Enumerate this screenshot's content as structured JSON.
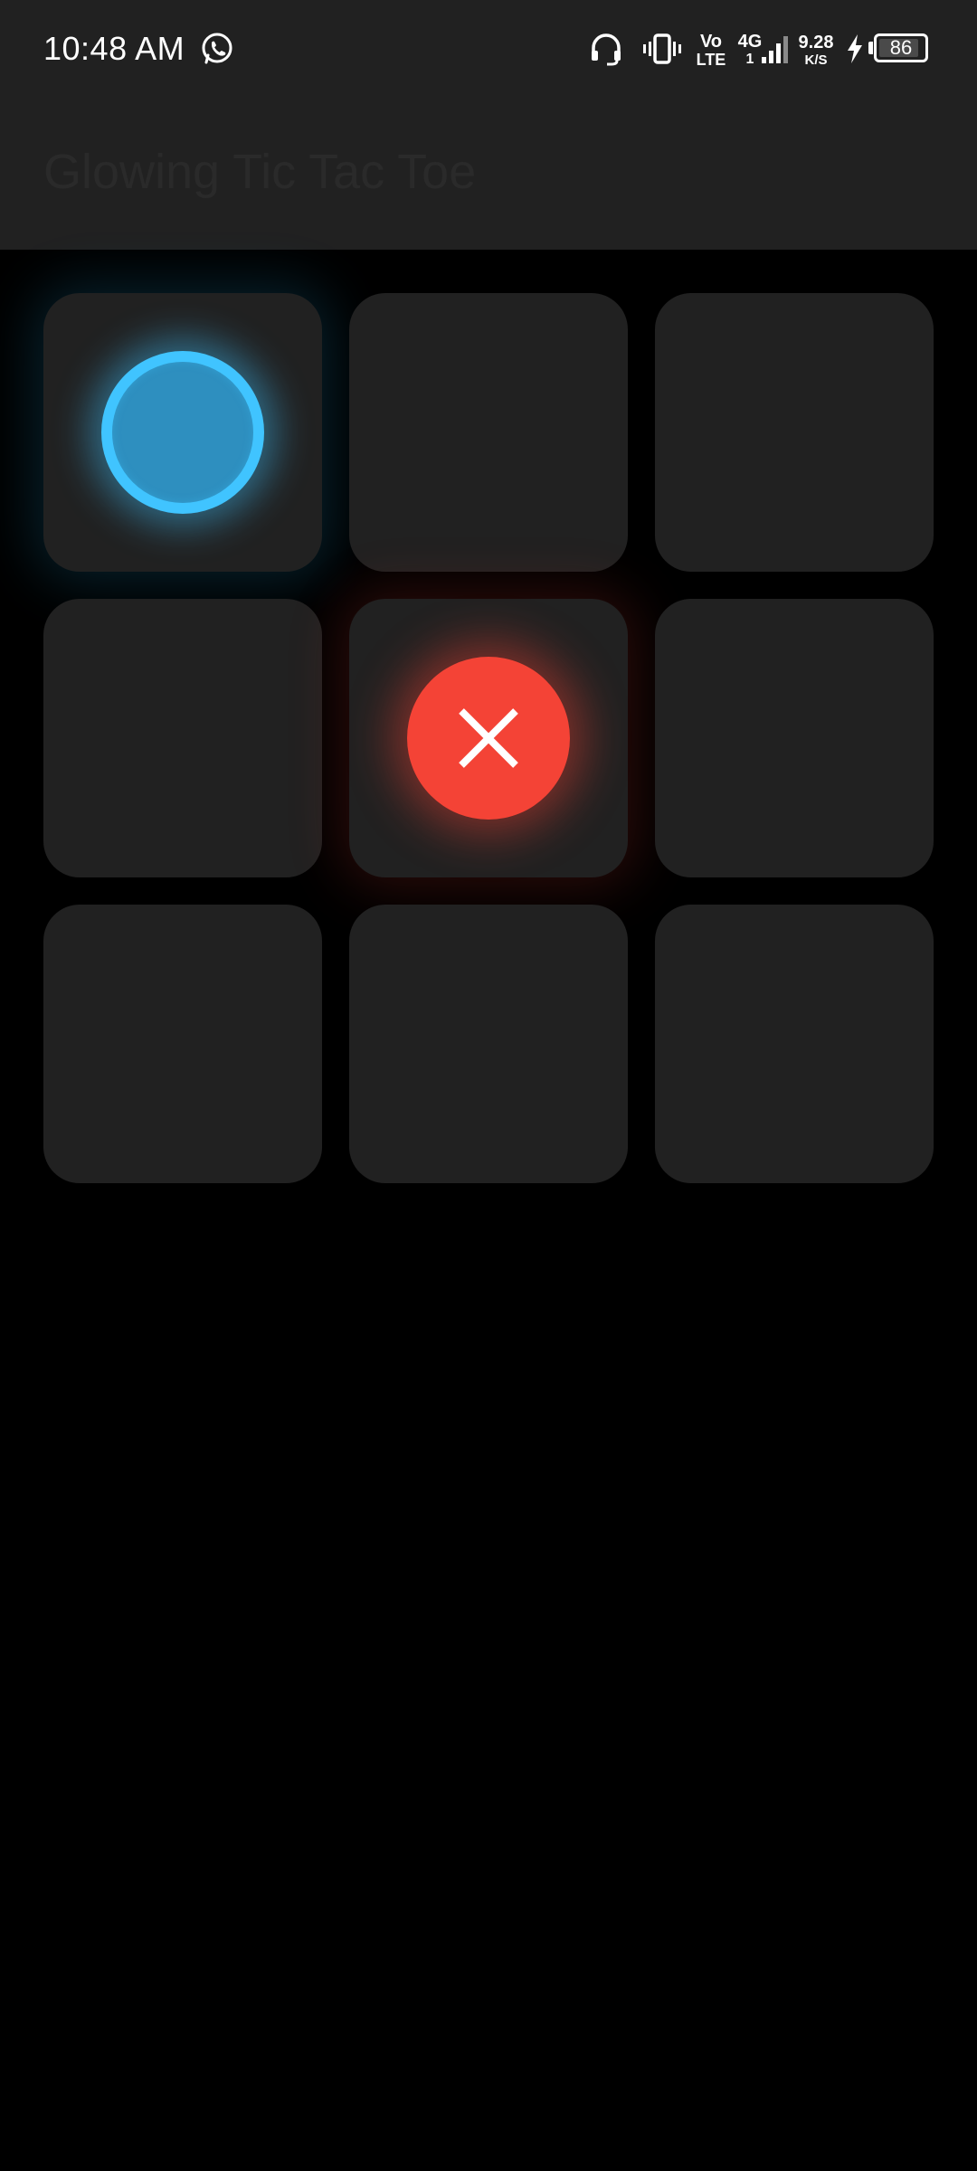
{
  "status_bar": {
    "time": "10:48 AM",
    "network_vo": "Vo",
    "network_lte": "LTE",
    "network_4g": "4G",
    "network_4g_sub": "1",
    "speed_value": "9.28",
    "speed_unit": "K/S",
    "battery_level": "86",
    "icons": [
      "whatsapp-icon",
      "headset-icon",
      "vibrate-icon",
      "signal-icon",
      "charging-icon",
      "battery-icon"
    ]
  },
  "app_bar": {
    "title": "Glowing Tic Tac Toe",
    "background": "#212121"
  },
  "board": {
    "cells": [
      "O",
      "",
      "",
      "",
      "X",
      "",
      "",
      "",
      ""
    ],
    "colors": {
      "o": "#40c4ff",
      "x": "#f44336",
      "cell": "#212121",
      "background": "#000000"
    }
  }
}
